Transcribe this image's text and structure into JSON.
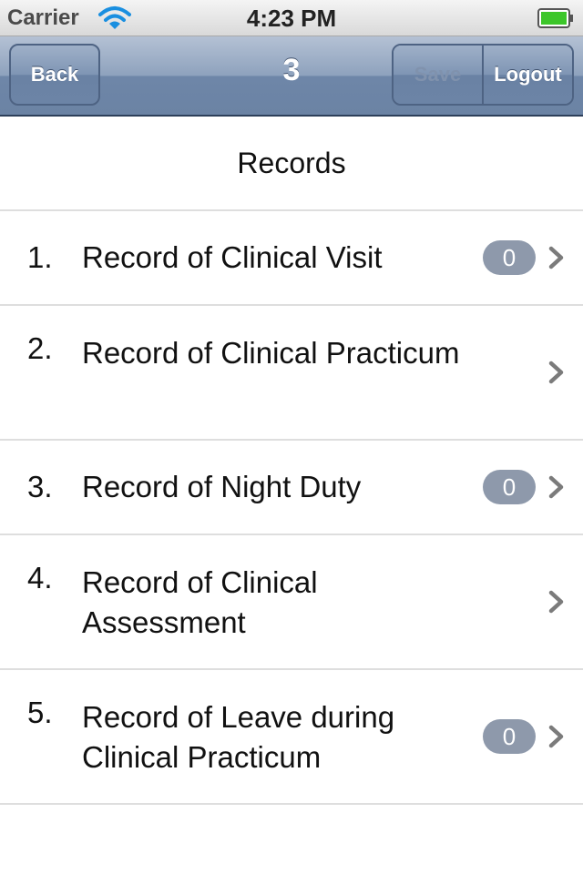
{
  "status": {
    "carrier": "Carrier",
    "time": "4:23 PM"
  },
  "nav": {
    "back_label": "Back",
    "title": "3",
    "save_label": "Save",
    "logout_label": "Logout"
  },
  "section": {
    "header": "Records"
  },
  "records": [
    {
      "num": "1.",
      "label": "Record of Clinical Visit",
      "badge": "0"
    },
    {
      "num": "2.",
      "label": "Record of Clinical Practicum"
    },
    {
      "num": "3.",
      "label": "Record of Night Duty",
      "badge": "0"
    },
    {
      "num": "4.",
      "label": "Record of Clinical Assessment"
    },
    {
      "num": "5.",
      "label": "Record of Leave during Clinical Practicum",
      "badge": "0"
    }
  ],
  "colors": {
    "badge": "#8e99ab",
    "nav_bar": "#6e86a8",
    "battery": "#3cc62a"
  }
}
